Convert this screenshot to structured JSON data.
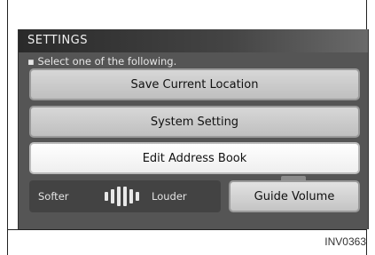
{
  "header": {
    "title": "SETTINGS"
  },
  "instruction": "Select one of the following.",
  "menu": {
    "items": [
      {
        "label": "Save Current Location",
        "selected": false
      },
      {
        "label": "System Setting",
        "selected": false
      },
      {
        "label": "Edit Address Book",
        "selected": true
      }
    ]
  },
  "volume": {
    "softer_label": "Softer",
    "louder_label": "Louder",
    "guide_button_label": "Guide Volume"
  },
  "figure_id": "INV0363"
}
